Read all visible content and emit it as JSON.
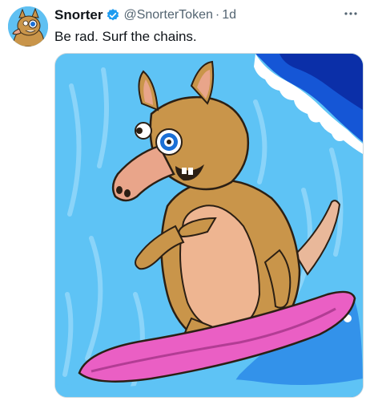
{
  "tweet": {
    "author": {
      "display_name": "Snorter",
      "handle": "@SnorterToken",
      "verified": true,
      "avatar_icon": "snorter-mascot-avatar"
    },
    "separator": "·",
    "time": "1d",
    "text": "Be rad. Surf the chains.",
    "more_icon": "more-horizontal-icon",
    "media": {
      "description_icon": "surfing-aardvark-illustration"
    }
  },
  "colors": {
    "text_primary": "#0f1419",
    "text_secondary": "#536471",
    "verified_blue": "#1d9bf0",
    "sky_blue": "#5ec3f5",
    "surfboard_pink": "#ea5fc4",
    "fur_brown": "#c9954a"
  }
}
